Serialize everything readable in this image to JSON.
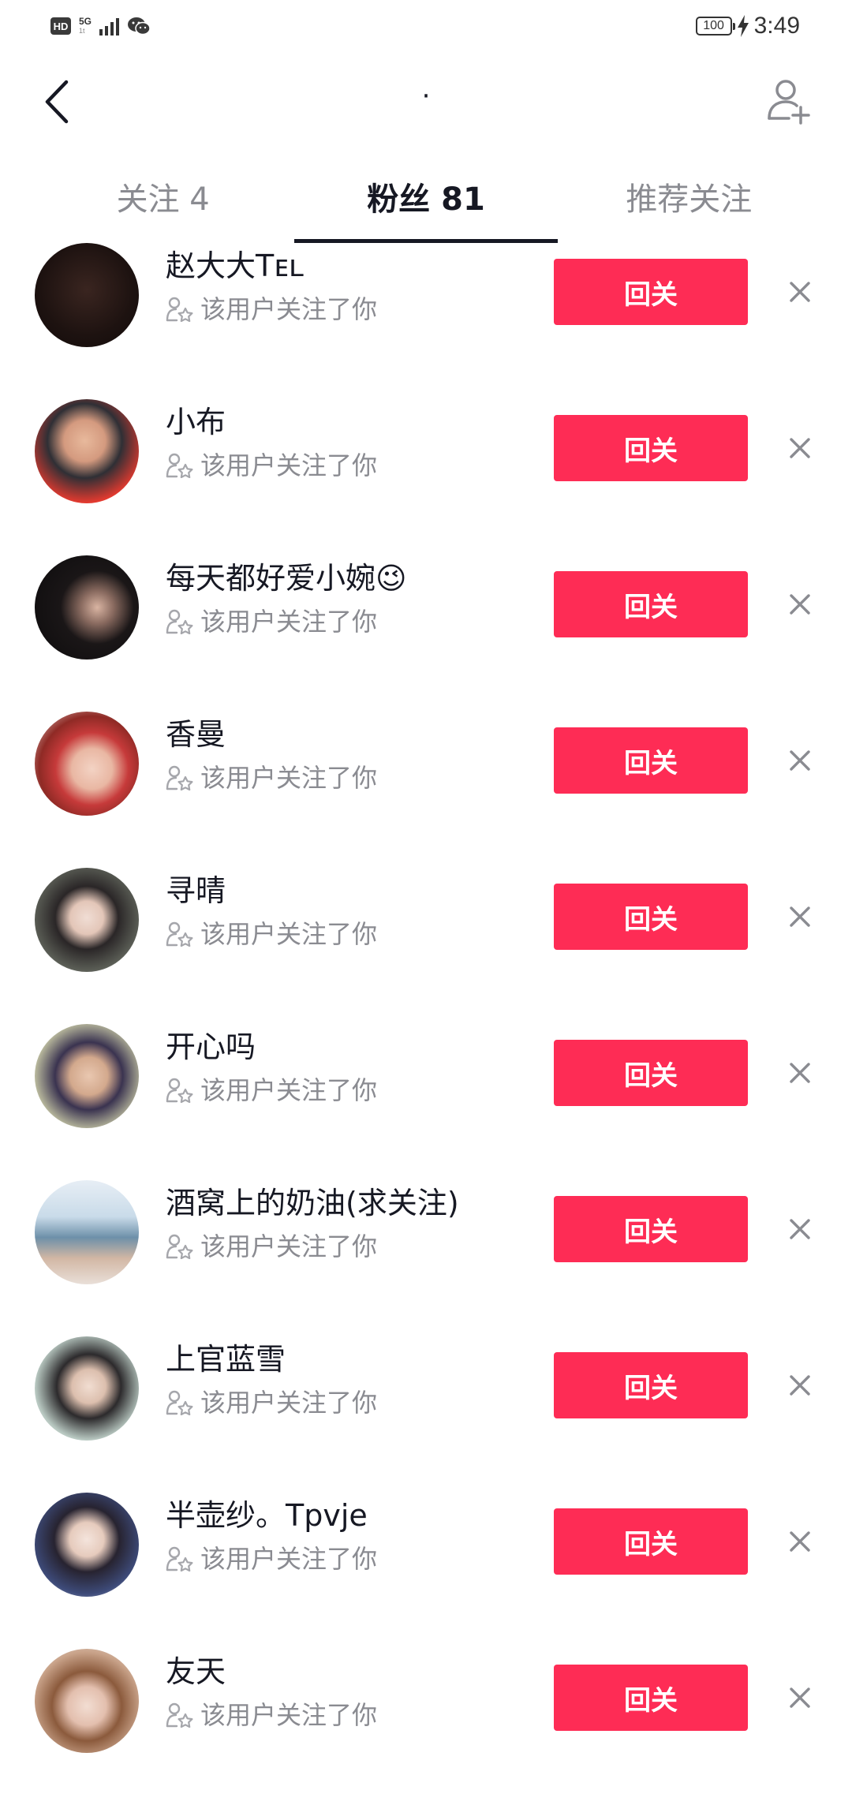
{
  "status_bar": {
    "hd_label": "HD",
    "network_label": "5G",
    "network_sub": "1t",
    "battery_level": "100",
    "time": "3:49",
    "icons": [
      "hd-icon",
      "signal-icon",
      "wechat-icon",
      "battery-icon",
      "charging-icon"
    ]
  },
  "header": {
    "title": "·",
    "back_icon": "chevron-left-icon",
    "add_friend_icon": "add-user-icon"
  },
  "tabs": [
    {
      "label": "关注 4",
      "active": false
    },
    {
      "label": "粉丝 81",
      "active": true
    },
    {
      "label": "推荐关注",
      "active": false
    }
  ],
  "followers": [
    {
      "name": "赵大大Tᴇʟ",
      "subtitle": "该用户关注了你",
      "button": "回关"
    },
    {
      "name": "小布",
      "subtitle": "该用户关注了你",
      "button": "回关"
    },
    {
      "name": "每天都好爱小婉😉",
      "subtitle": "该用户关注了你",
      "button": "回关"
    },
    {
      "name": "香曼",
      "subtitle": "该用户关注了你",
      "button": "回关"
    },
    {
      "name": "寻晴",
      "subtitle": "该用户关注了你",
      "button": "回关"
    },
    {
      "name": "开心吗",
      "subtitle": "该用户关注了你",
      "button": "回关"
    },
    {
      "name": "酒窝上的奶油(求关注)",
      "subtitle": "该用户关注了你",
      "button": "回关"
    },
    {
      "name": "上官蓝雪",
      "subtitle": "该用户关注了你",
      "button": "回关"
    },
    {
      "name": "半壶纱。Tpvje",
      "subtitle": "该用户关注了你",
      "button": "回关"
    },
    {
      "name": "友天",
      "subtitle": "该用户关注了你",
      "button": "回关"
    }
  ],
  "colors": {
    "accent": "#fe2c55",
    "primary_text": "#161823",
    "secondary_text": "#8a8b91"
  }
}
